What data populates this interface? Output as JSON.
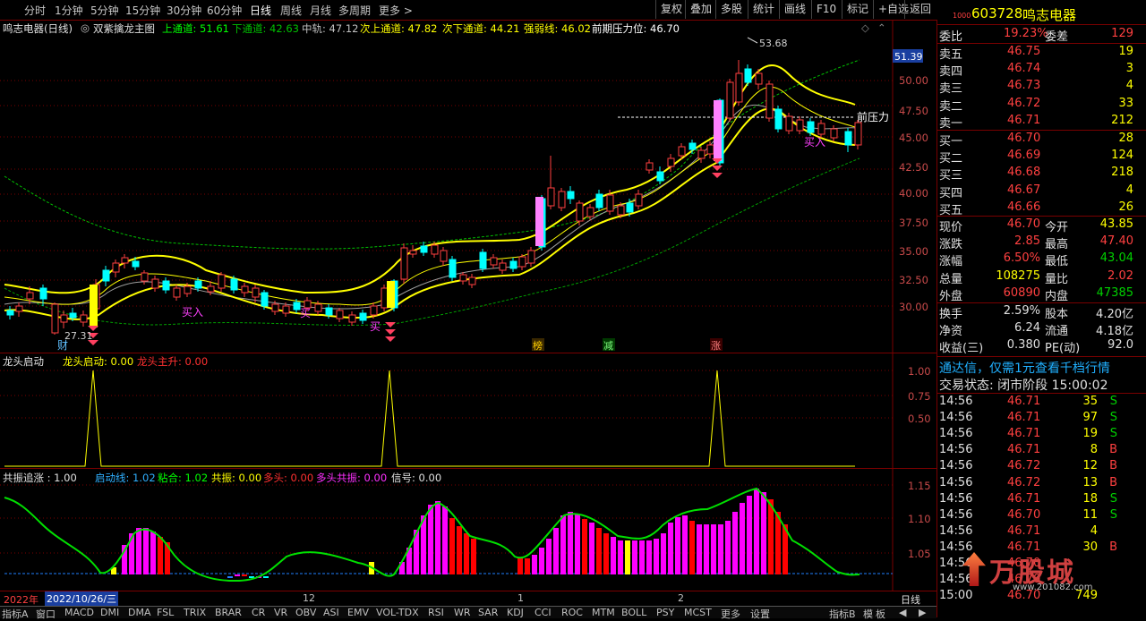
{
  "toolbar": {
    "periods": [
      "分时",
      "1分钟",
      "5分钟",
      "15分钟",
      "30分钟",
      "60分钟",
      "日线",
      "周线",
      "月线",
      "多周期",
      "更多 >"
    ],
    "active_period": "日线",
    "right_buttons": [
      "复权",
      "叠加",
      "多股",
      "统计",
      "画线",
      "F10",
      "标记",
      "+自选",
      "返回"
    ]
  },
  "main_legend": {
    "stock": "鸣志电器(日线)",
    "formula": "双紫擒龙主图",
    "items": [
      {
        "label": "上通道: 51.61",
        "color": "#00ff00"
      },
      {
        "label": "下通道: 42.63",
        "color": "#00c000"
      },
      {
        "label": "中轨: 47.12",
        "color": "#c0c0c0"
      },
      {
        "label": "次上通道: 47.82",
        "color": "#ffff00"
      },
      {
        "label": "次下通道: 44.21",
        "color": "#ffff00"
      },
      {
        "label": "强弱线: 46.02",
        "color": "#ffff00"
      },
      {
        "label": "前期压力位: 46.70",
        "color": "#ffffff"
      }
    ]
  },
  "main_axis": {
    "ticks": [
      "50.00",
      "47.50",
      "45.00",
      "42.50",
      "40.00",
      "37.50",
      "35.00",
      "32.50",
      "30.00"
    ],
    "current_price_tag": "51.39"
  },
  "main_annotations": {
    "high_label": "53.68",
    "low_label": "27.31",
    "resistance_label": "前压力",
    "markers": [
      "财",
      "榜",
      "减",
      "涨"
    ],
    "buy_label": "买入",
    "buy_label_short": "买"
  },
  "panel2": {
    "title": "龙头启动",
    "items": [
      {
        "label": "龙头启动: 0.00",
        "color": "#ffff00"
      },
      {
        "label": "龙头主升: 0.00",
        "color": "#ff3030"
      }
    ],
    "ticks": [
      "1.00",
      "0.75",
      "0.50"
    ]
  },
  "panel3": {
    "title": "共振追涨 : 1.00",
    "items": [
      {
        "label": "启动线: 1.02",
        "color": "#30b0ff"
      },
      {
        "label": "粘合: 1.02",
        "color": "#00ff00"
      },
      {
        "label": "共振: 0.00",
        "color": "#ffff00"
      },
      {
        "label": "多头: 0.00",
        "color": "#ff3030"
      },
      {
        "label": "多头共振: 0.00",
        "color": "#ff30ff"
      },
      {
        "label": "信号: 0.00",
        "color": "#e0e0e0"
      }
    ],
    "ticks": [
      "1.15",
      "1.10",
      "1.05"
    ]
  },
  "time_axis": {
    "year": "2022年",
    "date": "2022/10/26/三",
    "months": [
      "12",
      "1",
      "2"
    ],
    "period_btn": "日线"
  },
  "bottom_tabs": [
    "指标A",
    "窗口",
    "MACD",
    "DMI",
    "DMA",
    "FSL",
    "TRIX",
    "BRAR",
    "CR",
    "VR",
    "OBV",
    "ASI",
    "EMV",
    "VOL-TDX",
    "RSI",
    "WR",
    "SAR",
    "KDJ",
    "CCI",
    "ROC",
    "MTM",
    "BOLL",
    "PSY",
    "MCST",
    "更多",
    "设置",
    "指标B",
    "模",
    "板"
  ],
  "quote": {
    "code": "603728",
    "name": "鸣志电器",
    "level_tag": "1000",
    "weibi_label": "委比",
    "weibi": "19.23%",
    "weicha_label": "委差",
    "weicha": "129",
    "asks": [
      [
        "卖五",
        "46.75",
        "19"
      ],
      [
        "卖四",
        "46.74",
        "3"
      ],
      [
        "卖三",
        "46.73",
        "4"
      ],
      [
        "卖二",
        "46.72",
        "33"
      ],
      [
        "卖一",
        "46.71",
        "212"
      ]
    ],
    "bids": [
      [
        "买一",
        "46.70",
        "28"
      ],
      [
        "买二",
        "46.69",
        "124"
      ],
      [
        "买三",
        "46.68",
        "218"
      ],
      [
        "买四",
        "46.67",
        "4"
      ],
      [
        "买五",
        "46.66",
        "26"
      ]
    ],
    "stats": [
      [
        "现价",
        "46.70",
        "今开",
        "43.85"
      ],
      [
        "涨跌",
        "2.85",
        "最高",
        "47.40"
      ],
      [
        "涨幅",
        "6.50%",
        "最低",
        "43.04"
      ],
      [
        "总量",
        "108275",
        "量比",
        "2.02"
      ],
      [
        "外盘",
        "60890",
        "内盘",
        "47385"
      ]
    ],
    "stats2": [
      [
        "换手",
        "2.59%",
        "股本",
        "4.20亿"
      ],
      [
        "净资",
        "6.24",
        "流通",
        "4.18亿"
      ],
      [
        "收益(三)",
        "0.380",
        "PE(动)",
        "92.0"
      ]
    ],
    "promo": "通达信，仅需1元查看千档行情",
    "status": "交易状态: 闭市阶段 15:00:02",
    "ticks": [
      [
        "14:56",
        "46.71",
        "35",
        "S"
      ],
      [
        "14:56",
        "46.71",
        "97",
        "S"
      ],
      [
        "14:56",
        "46.71",
        "19",
        "S"
      ],
      [
        "14:56",
        "46.71",
        "8",
        "B"
      ],
      [
        "14:56",
        "46.72",
        "12",
        "B"
      ],
      [
        "14:56",
        "46.72",
        "13",
        "B"
      ],
      [
        "14:56",
        "46.71",
        "18",
        "S"
      ],
      [
        "14:56",
        "46.70",
        "11",
        "S"
      ],
      [
        "14:56",
        "46.71",
        "4",
        ""
      ],
      [
        "14:56",
        "46.71",
        "30",
        "B"
      ],
      [
        "14:56",
        "46.70",
        "",
        ""
      ],
      [
        "14:56",
        "46.70",
        "",
        ""
      ],
      [
        "15:00",
        "46.70",
        "749",
        ""
      ]
    ],
    "watermark": "万股城",
    "watermark_url": "www.201082.com"
  },
  "colors": {
    "up": "#ff4040",
    "down": "#00ffff",
    "ma": "#ffff00",
    "bg": "#000000",
    "grid": "#7a0000"
  }
}
